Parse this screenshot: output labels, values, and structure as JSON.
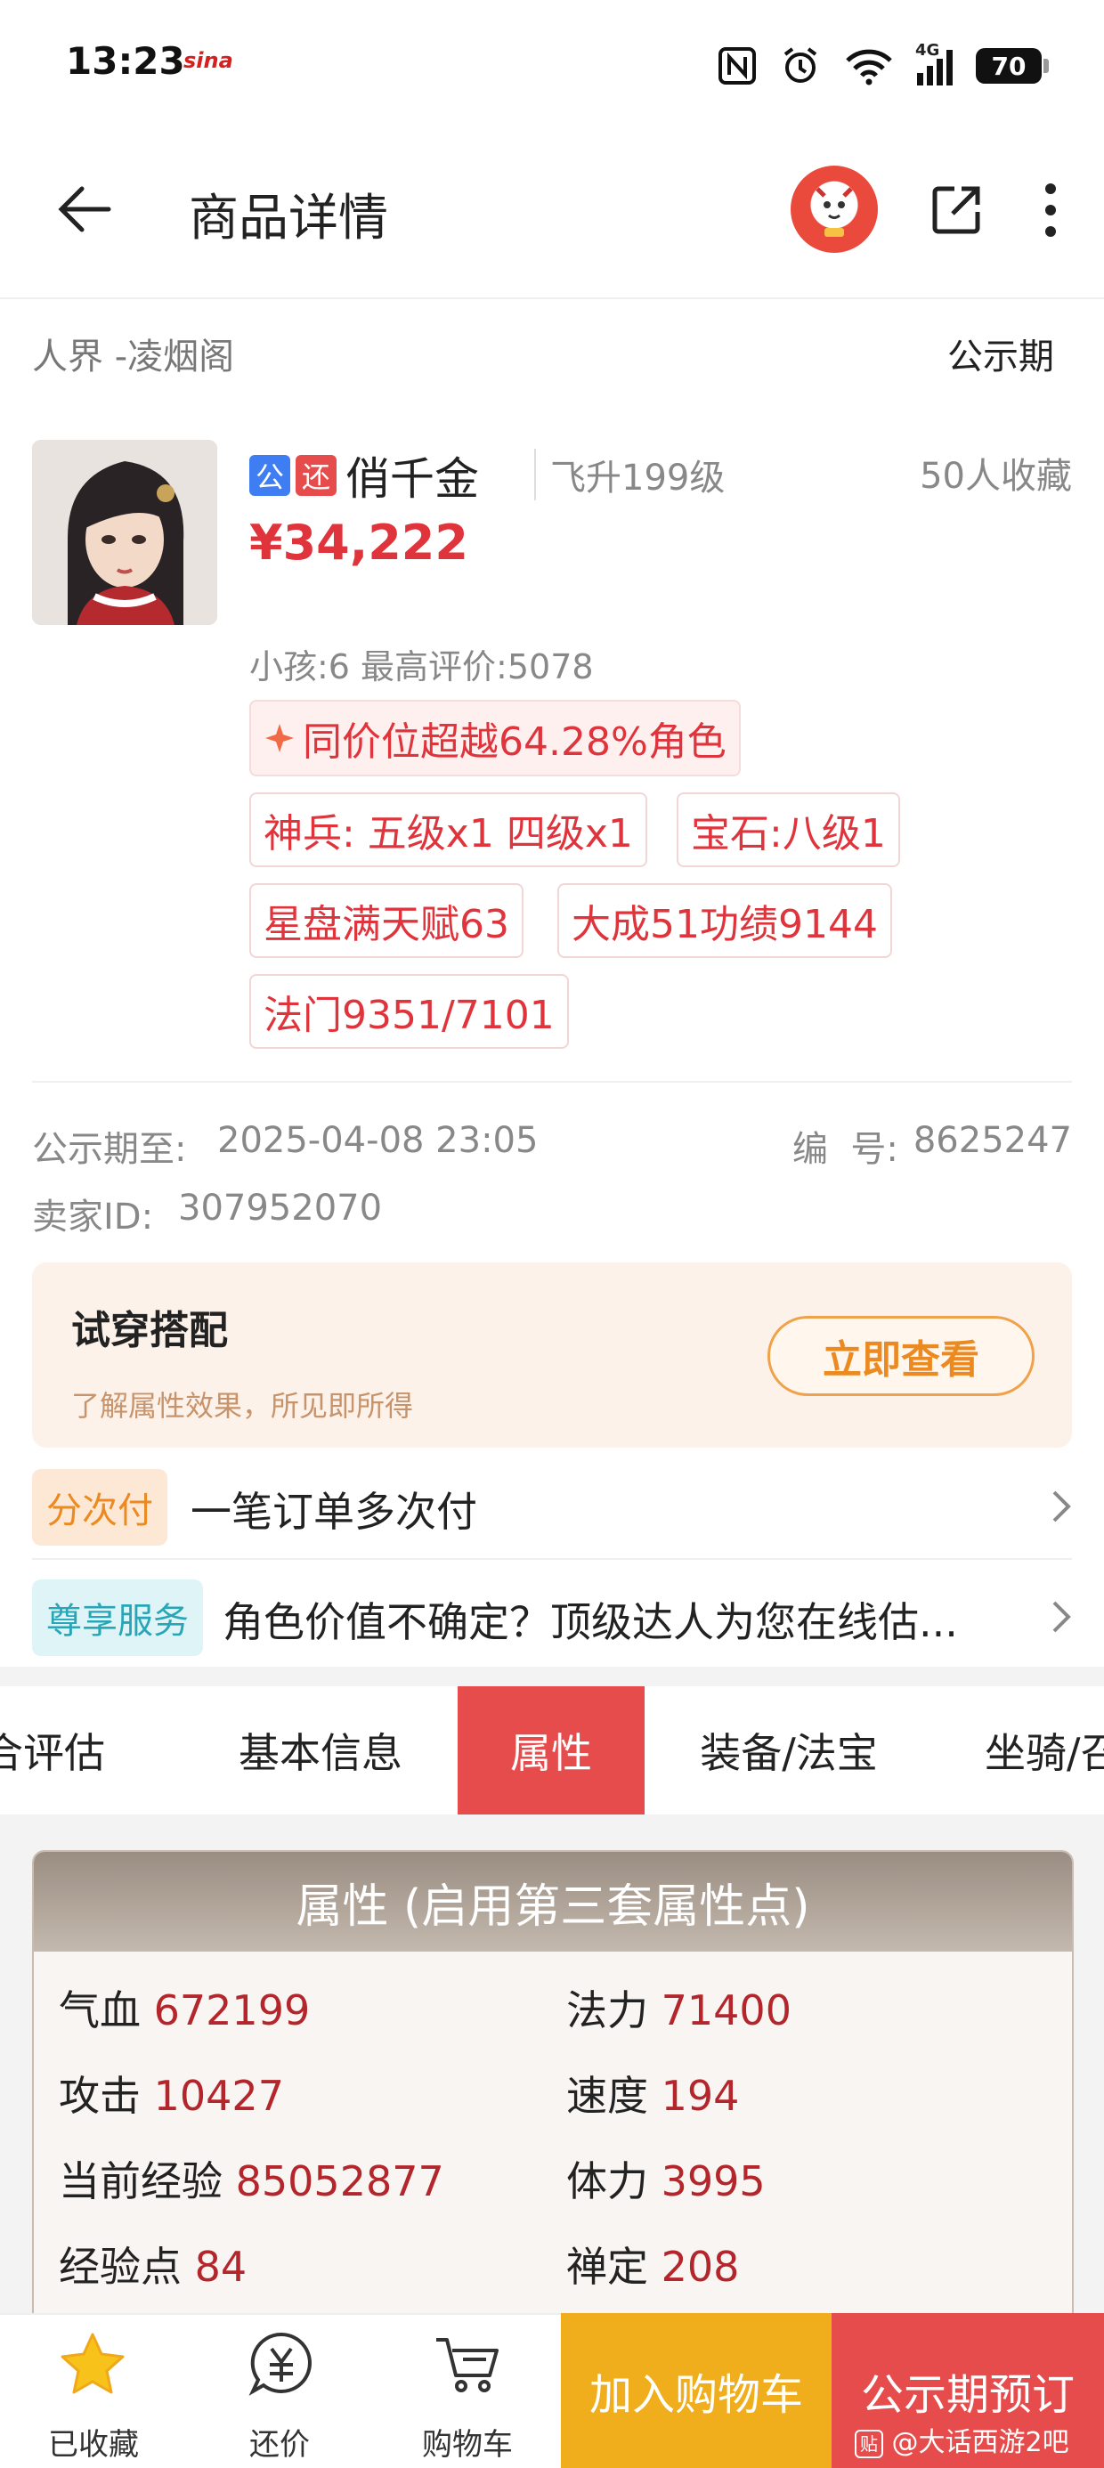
{
  "status_bar": {
    "time": "13:23",
    "carrier_logo": "sina",
    "network": "4G",
    "battery": "70"
  },
  "header": {
    "title": "商品详情"
  },
  "server": {
    "name": "人界 -凌烟阁",
    "period": "公示期"
  },
  "role": {
    "tag_public": "公",
    "tag_bargain": "还",
    "name": "俏千金",
    "level": "飞升199级",
    "favorites": "50人收藏",
    "price": "¥34,222",
    "kids_rating": "小孩:6 最高评价:5078",
    "highlight": "同价位超越64.28%角色",
    "chips": [
      "神兵: 五级x1 四级x1",
      "宝石:八级1",
      "星盘满天赋63",
      "大成51功绩9144",
      "法门9351/7101"
    ]
  },
  "meta": {
    "period_end_label": "公示期至:",
    "period_end_value": "2025-04-08 23:05",
    "serial_label": "编  号:",
    "serial_value": "8625247",
    "seller_label": "卖家ID:",
    "seller_value": "307952070"
  },
  "tryon": {
    "title": "试穿搭配",
    "subtitle": "了解属性效果，所见即所得",
    "button": "立即查看"
  },
  "services": [
    {
      "tag": "分次付",
      "text": "一笔订单多次付"
    },
    {
      "tag": "尊享服务",
      "text": "角色价值不确定？顶级达人为您在线估..."
    }
  ],
  "tabs": [
    "合评估",
    "基本信息",
    "属性",
    "装备/法宝",
    "坐骑/召"
  ],
  "attributes": {
    "title": "属性 (启用第三套属性点)",
    "rows": [
      {
        "label": "气血",
        "value": "672199"
      },
      {
        "label": "法力",
        "value": "71400"
      },
      {
        "label": "攻击",
        "value": "10427"
      },
      {
        "label": "速度",
        "value": "194"
      },
      {
        "label": "当前经验",
        "value": "85052877"
      },
      {
        "label": "体力",
        "value": "3995"
      },
      {
        "label": "经验点",
        "value": "84"
      },
      {
        "label": "禅定",
        "value": "208"
      }
    ]
  },
  "bottom_bar": {
    "favorited": "已收藏",
    "bargain": "还价",
    "cart": "购物车",
    "add_to_cart": "加入购物车",
    "reserve": "公示期预订",
    "watermark": "@大话西游2吧"
  },
  "colors": {
    "accent_red": "#e74c4c",
    "price_red": "#e0343c",
    "cart_yellow": "#f0ad1c",
    "star_yellow": "#f7c21a"
  }
}
